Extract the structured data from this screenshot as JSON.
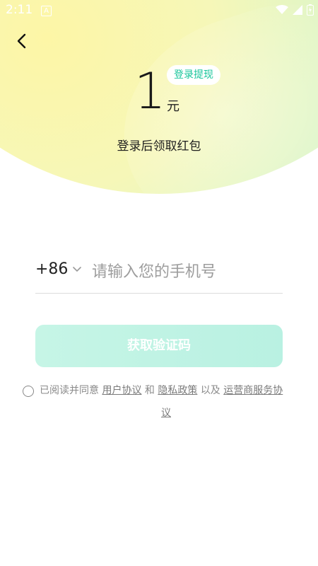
{
  "status_bar": {
    "time": "2:11",
    "a_badge": "A"
  },
  "hero": {
    "amount": "1",
    "unit": "元",
    "withdraw_badge": "登录提现",
    "subtitle": "登录后领取红包"
  },
  "login": {
    "country_code": "+86",
    "phone_placeholder": "请输入您的手机号",
    "get_code_label": "获取验证码"
  },
  "agreement": {
    "prefix": "已阅读并同意",
    "user_agreement": "用户协议",
    "and": "和",
    "privacy_policy": "隐私政策",
    "as_well_as": "以及",
    "carrier_service_a": "运营商服务协",
    "carrier_service_b": "议"
  },
  "colors": {
    "accent": "#17c59a",
    "button_bg": "#bff3e4"
  }
}
